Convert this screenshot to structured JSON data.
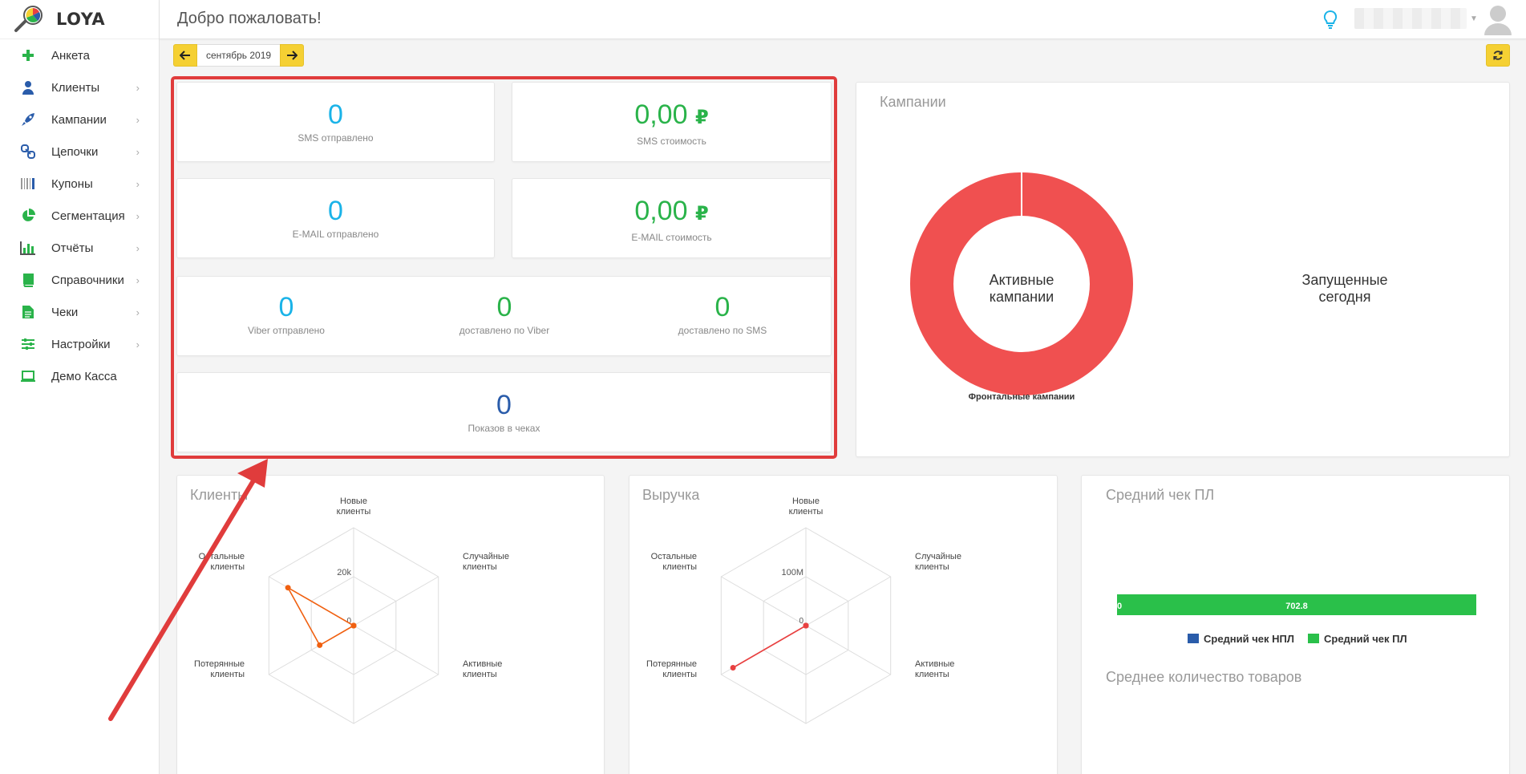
{
  "brand": {
    "name": "LOYA"
  },
  "header": {
    "welcome": "Добро пожаловать!"
  },
  "sidebar": {
    "items": [
      {
        "label": "Анкета",
        "icon": "plus-icon",
        "color": "#2ab34a",
        "has_children": false
      },
      {
        "label": "Клиенты",
        "icon": "user-icon",
        "color": "#2a5caa",
        "has_children": true
      },
      {
        "label": "Кампании",
        "icon": "rocket-icon",
        "color": "#2a5caa",
        "has_children": true
      },
      {
        "label": "Цепочки",
        "icon": "link-icon",
        "color": "#2a5caa",
        "has_children": true
      },
      {
        "label": "Купоны",
        "icon": "barcode-icon",
        "color": "#2a5caa",
        "has_children": true
      },
      {
        "label": "Сегментация",
        "icon": "pie-icon",
        "color": "#2ab34a",
        "has_children": true
      },
      {
        "label": "Отчёты",
        "icon": "bar-chart-icon",
        "color": "#2ab34a",
        "has_children": true
      },
      {
        "label": "Справочники",
        "icon": "book-icon",
        "color": "#2ab34a",
        "has_children": true
      },
      {
        "label": "Чеки",
        "icon": "file-icon",
        "color": "#2ab34a",
        "has_children": true
      },
      {
        "label": "Настройки",
        "icon": "sliders-icon",
        "color": "#2ab34a",
        "has_children": true
      },
      {
        "label": "Демо Касса",
        "icon": "laptop-icon",
        "color": "#2ab34a",
        "has_children": false
      }
    ]
  },
  "period": {
    "label": "сентябрь 2019"
  },
  "stats": {
    "sms_sent": {
      "value": "0",
      "caption": "SMS отправлено"
    },
    "sms_cost": {
      "value": "0,00",
      "currency": "₽",
      "caption": "SMS стоимость"
    },
    "email_sent": {
      "value": "0",
      "caption": "E-MAIL отправлено"
    },
    "email_cost": {
      "value": "0,00",
      "currency": "₽",
      "caption": "E-MAIL стоимость"
    },
    "viber_sent": {
      "value": "0",
      "caption": "Viber отправлено"
    },
    "viber_delivered": {
      "value": "0",
      "caption": "доставлено по Viber"
    },
    "sms_delivered": {
      "value": "0",
      "caption": "доставлено по SMS"
    },
    "receipt_views": {
      "value": "0",
      "caption": "Показов в чеках"
    }
  },
  "campaigns": {
    "title": "Кампании",
    "donut_center_line1": "Активные",
    "donut_center_line2": "кампании",
    "donut_label": "Фронтальные кампании",
    "launched_line1": "Запущенные",
    "launched_line2": "сегодня",
    "donut_color": "#f05050"
  },
  "clients_panel": {
    "title": "Клиенты",
    "axes": [
      {
        "line1": "Новые",
        "line2": "клиенты"
      },
      {
        "line1": "Случайные",
        "line2": "клиенты"
      },
      {
        "line1": "Активные",
        "line2": "клиенты"
      },
      {
        "line1": "",
        "line2": ""
      },
      {
        "line1": "Потерянные",
        "line2": "клиенты"
      },
      {
        "line1": "Остальные",
        "line2": "клиенты"
      }
    ],
    "scale_labels": [
      "20k",
      "0"
    ],
    "series_color": "#f06010"
  },
  "revenue_panel": {
    "title": "Выручка",
    "axes": [
      {
        "line1": "Новые",
        "line2": "клиенты"
      },
      {
        "line1": "Случайные",
        "line2": "клиенты"
      },
      {
        "line1": "Активные",
        "line2": "клиенты"
      },
      {
        "line1": "",
        "line2": ""
      },
      {
        "line1": "Потерянные",
        "line2": "клиенты"
      },
      {
        "line1": "Остальные",
        "line2": "клиенты"
      }
    ],
    "scale_labels": [
      "100M",
      "0"
    ],
    "series_color": "#e84040"
  },
  "avg_check": {
    "title": "Средний чек ПЛ",
    "bar_start_label": "0",
    "bar_value_label": "702.8",
    "legend_npl": "Средний чек НПЛ",
    "legend_pl": "Средний чек ПЛ",
    "color_npl": "#2a5caa",
    "color_pl": "#2ac04a",
    "subtitle": "Среднее количество товаров"
  },
  "chart_data": [
    {
      "type": "pie",
      "title": "Кампании",
      "categories": [
        "Фронтальные кампании"
      ],
      "values": [
        1
      ]
    },
    {
      "type": "radar",
      "title": "Клиенты",
      "categories": [
        "Новые клиенты",
        "Случайные клиенты",
        "Активные клиенты",
        "",
        "Потерянные клиенты",
        "Остальные клиенты"
      ],
      "values": [
        0,
        0,
        0,
        0,
        16000,
        31000
      ],
      "scale_max": 40000
    },
    {
      "type": "radar",
      "title": "Выручка",
      "categories": [
        "Новые клиенты",
        "Случайные клиенты",
        "Активные клиенты",
        "",
        "Потерянные клиенты",
        "Остальные клиенты"
      ],
      "values": [
        0,
        0,
        0,
        0,
        172000000,
        0
      ],
      "scale_max": 200000000
    },
    {
      "type": "bar",
      "title": "Средний чек ПЛ",
      "series": [
        {
          "name": "Средний чек НПЛ",
          "values": [
            0
          ]
        },
        {
          "name": "Средний чек ПЛ",
          "values": [
            702.8
          ]
        }
      ]
    }
  ]
}
